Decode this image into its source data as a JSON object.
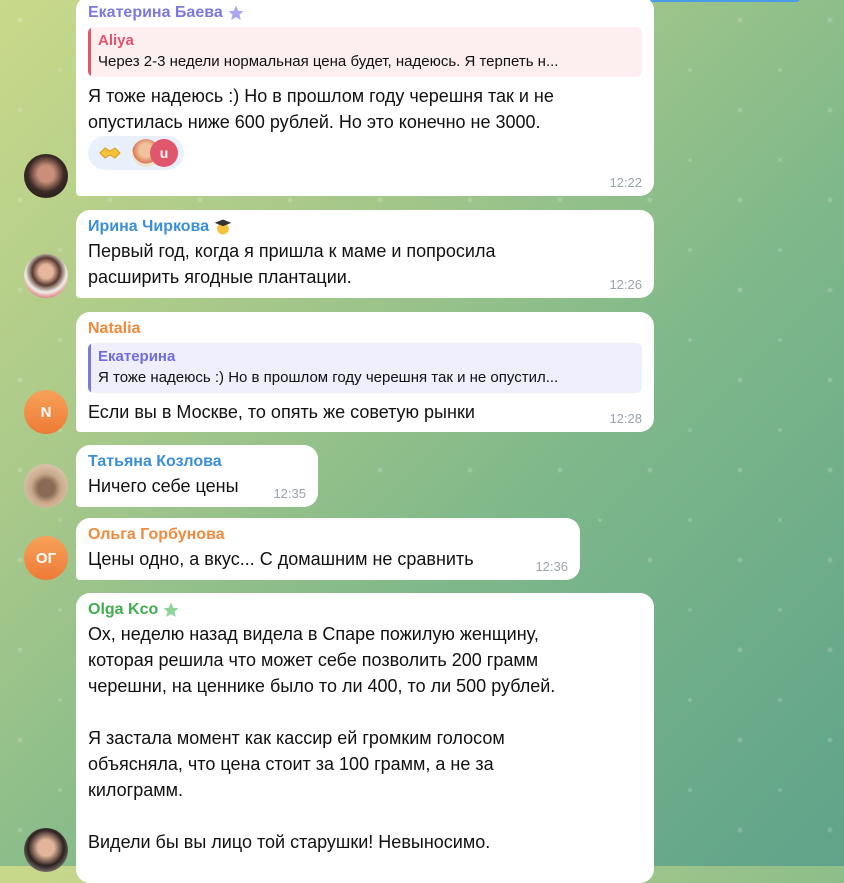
{
  "messages": [
    {
      "name": "Екатерина Баева",
      "name_color": "#7b79e0",
      "badge": "star-icon",
      "reply": {
        "name": "Aliya",
        "text": "Через 2-3 недели нормальная цена будет, надеюсь. Я терпеть н..."
      },
      "text": "Я тоже надеюсь :) Но в прошлом году черешня так и не\nопустилась ниже 600 рублей. Но это конечно не 3000.",
      "time": "12:22",
      "reactions": {
        "emoji": "handshake",
        "avatar_letter": "u"
      }
    },
    {
      "name": "Ирина Чиркова",
      "name_color": "#3a8fd8",
      "badge": "graduation-emoji",
      "text": "Первый год, когда я пришла к маме и попросила\nрасширить ягодные плантации.",
      "time": "12:26"
    },
    {
      "name": "Natalia",
      "name_color": "#f08a3c",
      "reply": {
        "name": "Екатерина",
        "text": "Я тоже надеюсь :) Но в прошлом году черешня так и не опустил..."
      },
      "text": "Если вы в Москве, то опять же советую рынки",
      "time": "12:28",
      "avatar_letter": "N"
    },
    {
      "name": "Татьяна Козлова",
      "name_color": "#3a8fd8",
      "text": "Ничего себе цены",
      "time": "12:35"
    },
    {
      "name": "Ольга Горбунова",
      "name_color": "#f08a3c",
      "text": "Цены одно, а вкус... С домашним не сравнить",
      "time": "12:36",
      "avatar_letter": "ОГ"
    },
    {
      "name": "Olga Kco",
      "name_color": "#3fae4d",
      "badge": "star-icon",
      "text": "Ох, неделю назад видела в Спаре пожилую женщину,\nкоторая решила что может себе позволить 200 грамм\nчерешни, на ценнике было то ли 400, то ли 500 рублей.\n\nЯ застала момент как кассир ей громким голосом\nобъясняла, что цена стоит за 100 грамм, а не за\nкилограмм.\n\nВидели бы вы лицо той старушки! Невыносимо."
    }
  ]
}
